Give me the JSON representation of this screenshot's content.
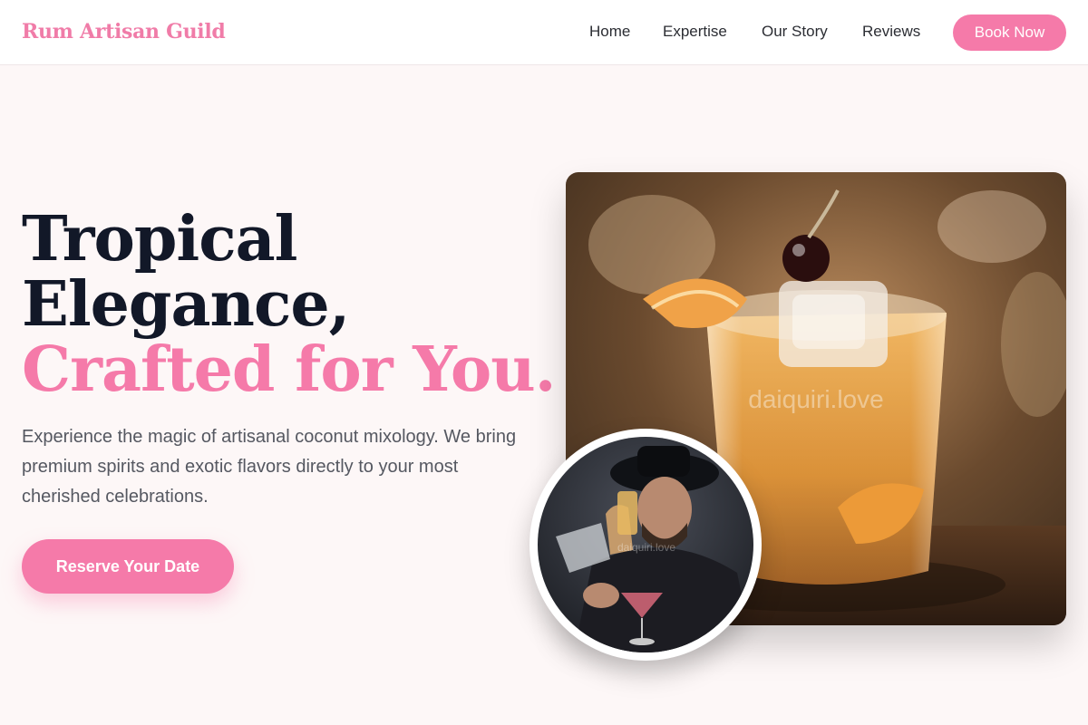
{
  "nav": {
    "brand": "Rum Artisan Guild",
    "links": [
      "Home",
      "Expertise",
      "Our Story",
      "Reviews"
    ],
    "cta": "Book Now"
  },
  "hero": {
    "title_line1": "Tropical",
    "title_line2": "Elegance,",
    "title_line3": "Crafted for You.",
    "description": "Experience the magic of artisanal coconut mixology. We bring premium spirits and exotic flavors directly to your most cherished celebrations.",
    "cta": "Reserve Your Date"
  },
  "images": {
    "main_photo": "cocktail-photo",
    "main_watermark": "daiquiri.love",
    "round_photo": "bartender-photo",
    "round_watermark": "daiquiri.love"
  },
  "colors": {
    "accent": "#f57aa9",
    "heading": "#121828",
    "background": "#fdf7f7"
  }
}
